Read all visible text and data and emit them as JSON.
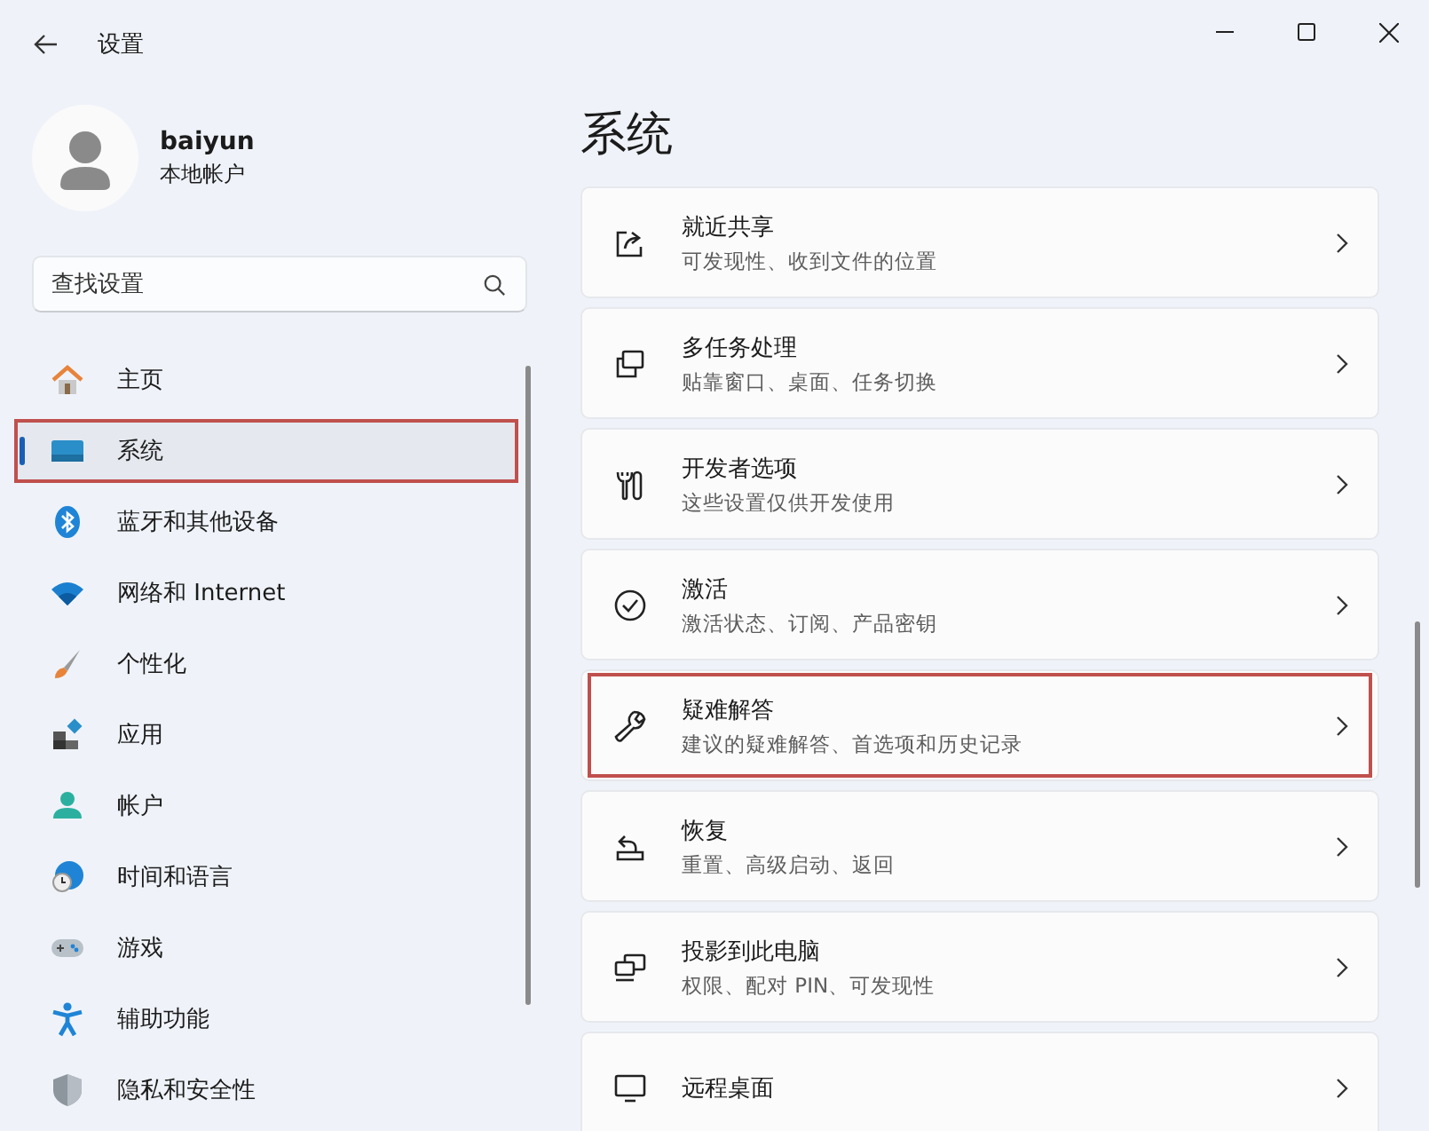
{
  "window": {
    "title": "设置"
  },
  "user": {
    "name": "baiyun",
    "account_type": "本地帐户"
  },
  "search": {
    "placeholder": "查找设置"
  },
  "nav": [
    {
      "label": "主页",
      "selected": false,
      "highlighted": false
    },
    {
      "label": "系统",
      "selected": true,
      "highlighted": true
    },
    {
      "label": "蓝牙和其他设备",
      "selected": false,
      "highlighted": false
    },
    {
      "label": "网络和 Internet",
      "selected": false,
      "highlighted": false
    },
    {
      "label": "个性化",
      "selected": false,
      "highlighted": false
    },
    {
      "label": "应用",
      "selected": false,
      "highlighted": false
    },
    {
      "label": "帐户",
      "selected": false,
      "highlighted": false
    },
    {
      "label": "时间和语言",
      "selected": false,
      "highlighted": false
    },
    {
      "label": "游戏",
      "selected": false,
      "highlighted": false
    },
    {
      "label": "辅助功能",
      "selected": false,
      "highlighted": false
    },
    {
      "label": "隐私和安全性",
      "selected": false,
      "highlighted": false
    }
  ],
  "page": {
    "title": "系统"
  },
  "cards": [
    {
      "title": "就近共享",
      "subtitle": "可发现性、收到文件的位置",
      "highlighted": false
    },
    {
      "title": "多任务处理",
      "subtitle": "贴靠窗口、桌面、任务切换",
      "highlighted": false
    },
    {
      "title": "开发者选项",
      "subtitle": "这些设置仅供开发使用",
      "highlighted": false
    },
    {
      "title": "激活",
      "subtitle": "激活状态、订阅、产品密钥",
      "highlighted": false
    },
    {
      "title": "疑难解答",
      "subtitle": "建议的疑难解答、首选项和历史记录",
      "highlighted": true
    },
    {
      "title": "恢复",
      "subtitle": "重置、高级启动、返回",
      "highlighted": false
    },
    {
      "title": "投影到此电脑",
      "subtitle": "权限、配对 PIN、可发现性",
      "highlighted": false
    },
    {
      "title": "远程桌面",
      "highlighted": false
    }
  ]
}
